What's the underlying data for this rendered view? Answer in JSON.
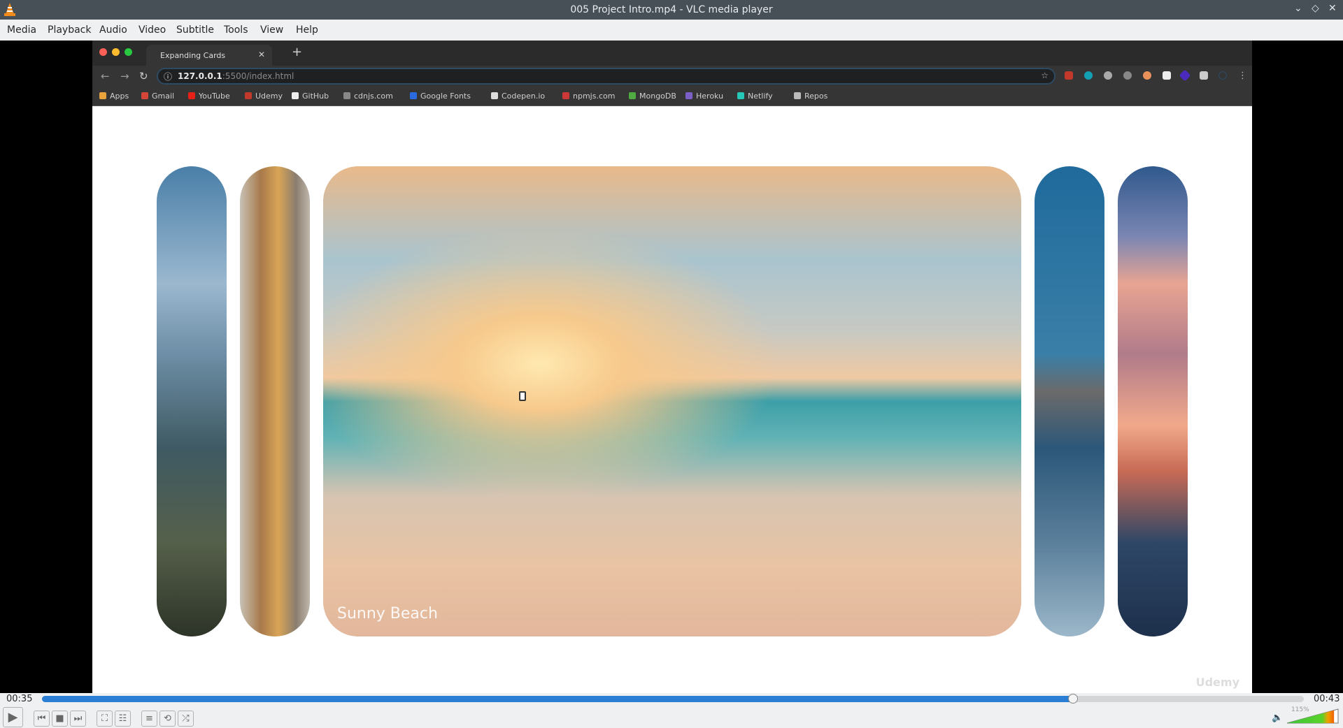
{
  "window": {
    "title": "005 Project Intro.mp4 - VLC media player",
    "controls": [
      "minimize",
      "maximize",
      "close"
    ]
  },
  "menu": [
    "Media",
    "Playback",
    "Audio",
    "Video",
    "Subtitle",
    "Tools",
    "View",
    "Help"
  ],
  "browser": {
    "tab_title": "Expanding Cards",
    "url_host": "127.0.0.1",
    "url_rest": ":5500/index.html",
    "bookmarks": [
      {
        "label": "Apps",
        "color": "#e8a33d"
      },
      {
        "label": "Gmail",
        "color": "#d44638"
      },
      {
        "label": "YouTube",
        "color": "#e62117"
      },
      {
        "label": "Udemy",
        "color": "#c0392b"
      },
      {
        "label": "GitHub",
        "color": "#eeeeee"
      },
      {
        "label": "cdnjs.com",
        "color": "#888888"
      },
      {
        "label": "Google Fonts",
        "color": "#2a6be0"
      },
      {
        "label": "Codepen.io",
        "color": "#dddddd"
      },
      {
        "label": "npmjs.com",
        "color": "#cb3837"
      },
      {
        "label": "MongoDB",
        "color": "#4faa41"
      },
      {
        "label": "Heroku",
        "color": "#7b5fc7"
      },
      {
        "label": "Netlify",
        "color": "#25c7b7"
      },
      {
        "label": "Repos",
        "color": "#bbbbbb"
      }
    ],
    "page": {
      "active_card_label": "Sunny Beach",
      "watermark": "Udemy"
    }
  },
  "player": {
    "elapsed": "00:35",
    "total": "00:43",
    "progress": 0.817,
    "volume_label": "115%",
    "volume": 1.15
  }
}
